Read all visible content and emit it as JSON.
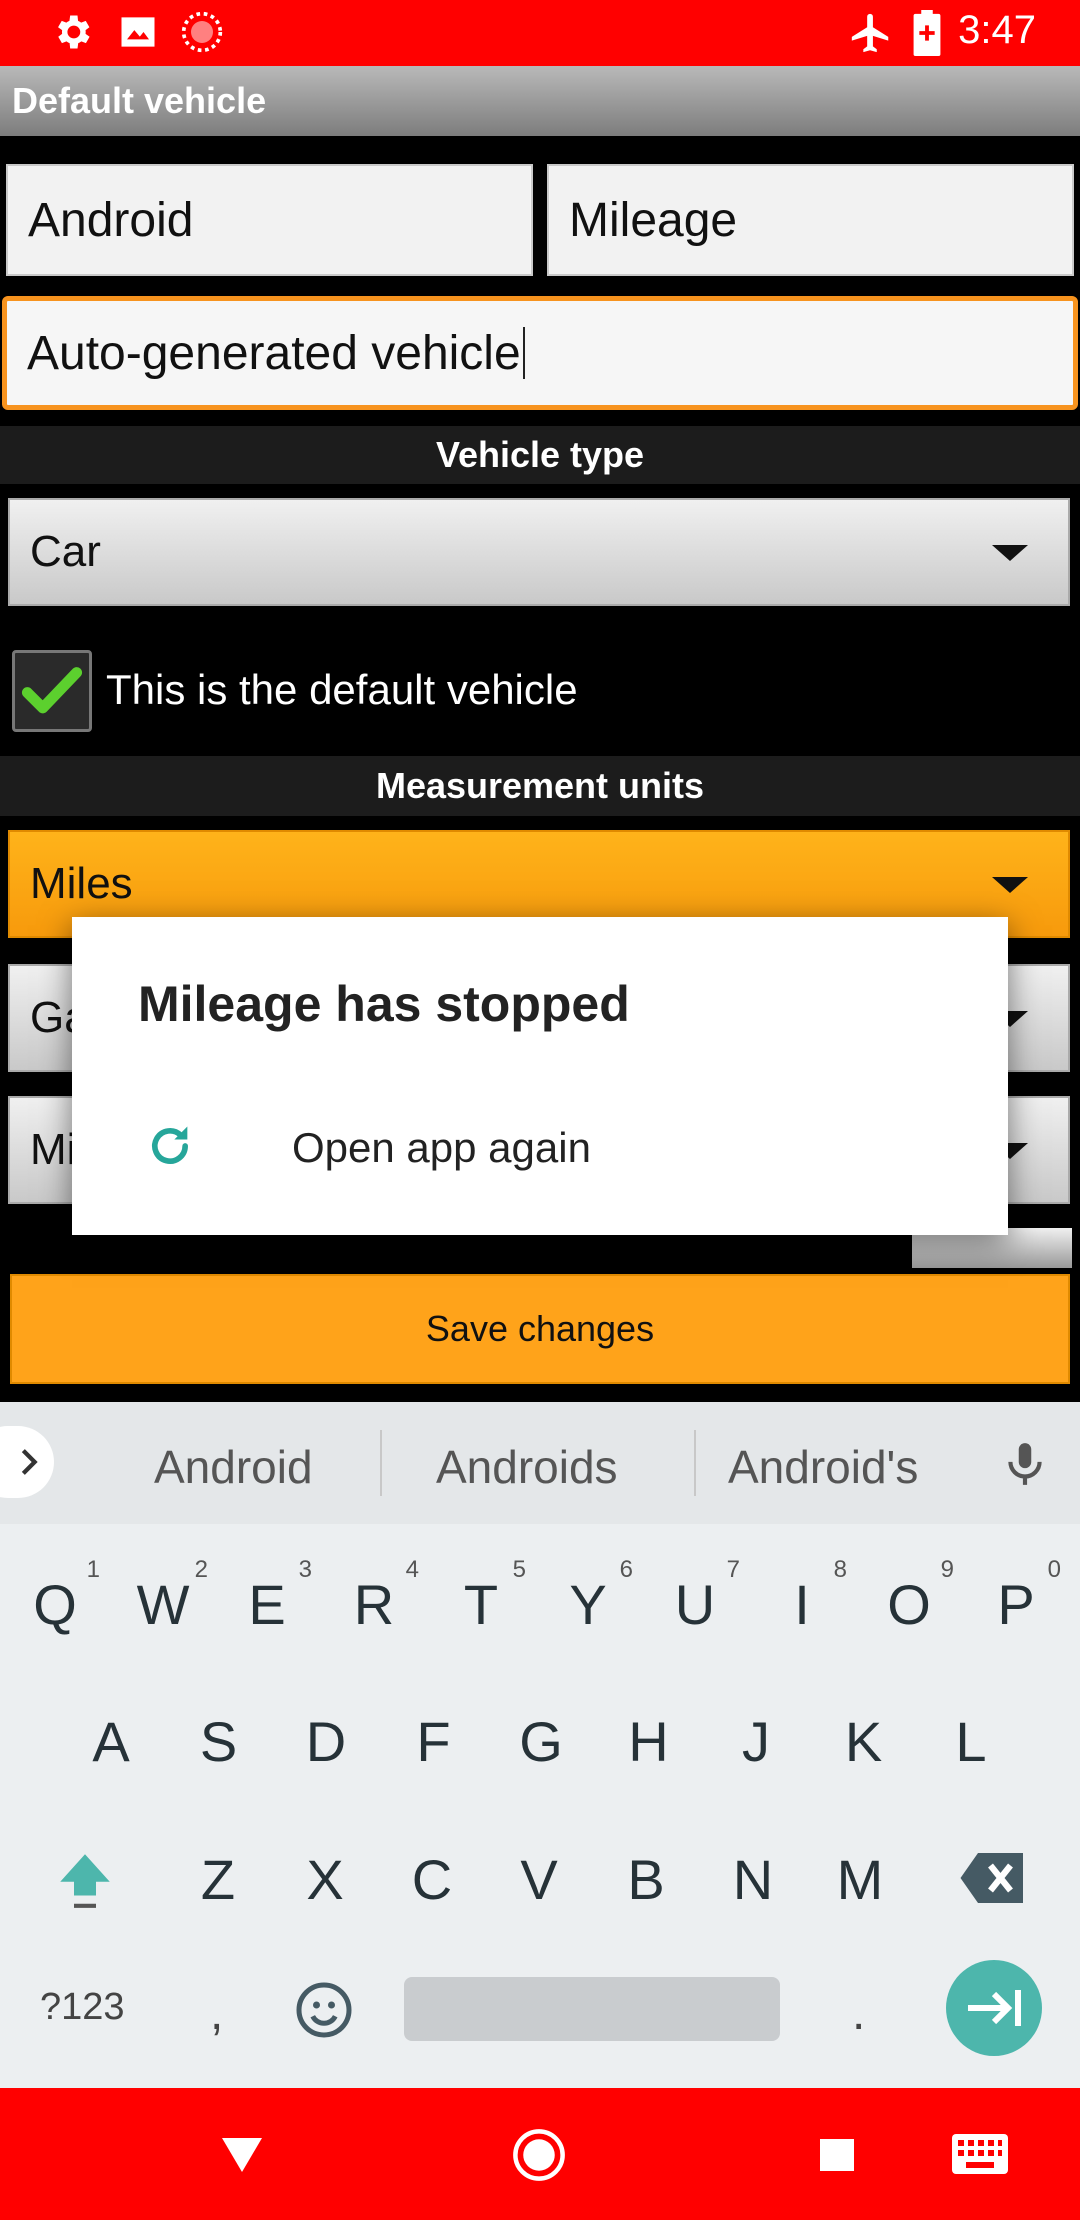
{
  "status_bar": {
    "time": "3:47",
    "left_icons": [
      "settings-icon",
      "image-icon",
      "record-icon"
    ],
    "right_icons": [
      "airplane-icon",
      "battery-icon"
    ],
    "color": "#ff0000"
  },
  "app_bar": {
    "title": "Default vehicle"
  },
  "form": {
    "make_value": "Android",
    "model_value": "Mileage",
    "description_value": "Auto-generated vehicle",
    "vehicle_type_header": "Vehicle type",
    "vehicle_type_value": "Car",
    "default_checkbox_label": "This is the default vehicle",
    "default_checked": true,
    "measurement_header": "Measurement units",
    "distance_unit": "Miles",
    "volume_unit_partial": "Ga",
    "economy_unit_partial": "Mi",
    "save_label": "Save changes"
  },
  "dialog": {
    "title": "Mileage has stopped",
    "action_label": "Open app again",
    "action_icon": "refresh-icon"
  },
  "keyboard": {
    "suggestions": [
      "Android",
      "Androids",
      "Android's"
    ],
    "row1": [
      {
        "k": "Q",
        "n": "1"
      },
      {
        "k": "W",
        "n": "2"
      },
      {
        "k": "E",
        "n": "3"
      },
      {
        "k": "R",
        "n": "4"
      },
      {
        "k": "T",
        "n": "5"
      },
      {
        "k": "Y",
        "n": "6"
      },
      {
        "k": "U",
        "n": "7"
      },
      {
        "k": "I",
        "n": "8"
      },
      {
        "k": "O",
        "n": "9"
      },
      {
        "k": "P",
        "n": "0"
      }
    ],
    "row2": [
      "A",
      "S",
      "D",
      "F",
      "G",
      "H",
      "J",
      "K",
      "L"
    ],
    "row3": [
      "Z",
      "X",
      "C",
      "V",
      "B",
      "N",
      "M"
    ],
    "symbols_label": "?123",
    "comma": ",",
    "period": ".",
    "accent_color": "#4db6ac"
  },
  "nav_bar": {
    "color": "#ff0000",
    "icons": [
      "back-icon",
      "home-icon",
      "recents-icon",
      "keyboard-icon"
    ]
  }
}
